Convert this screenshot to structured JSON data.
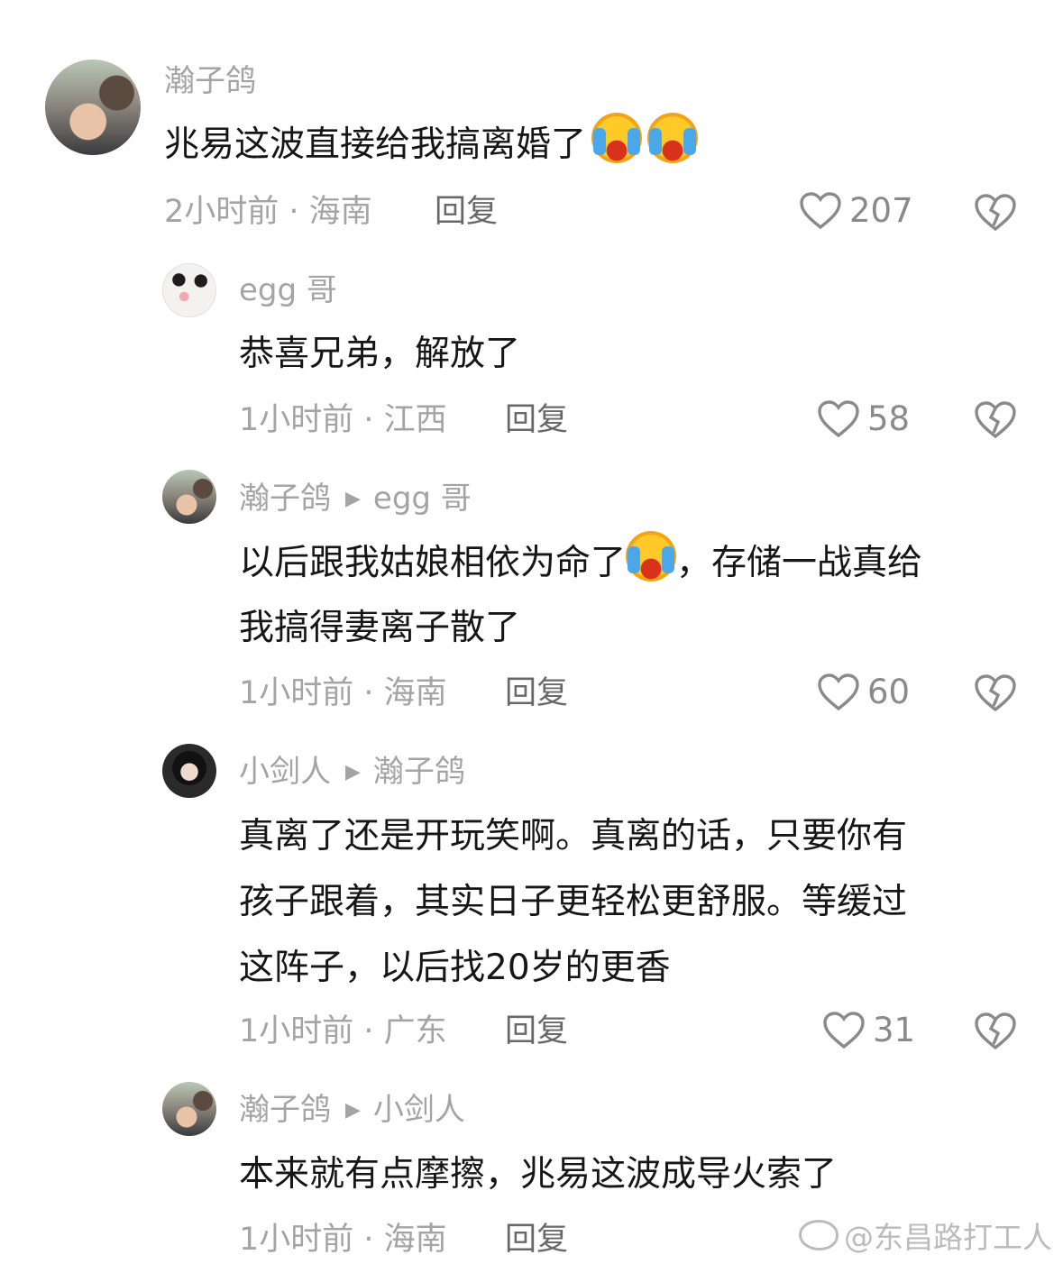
{
  "comments": [
    {
      "username": "瀚子鸽",
      "text": "兆易这波直接给我搞离婚了",
      "time_location": "2小时前 · 海南",
      "reply_label": "回复",
      "likes": "207"
    },
    {
      "username": "egg 哥",
      "text": "恭喜兄弟，解放了",
      "time_location": "1小时前 · 江西",
      "reply_label": "回复",
      "likes": "58"
    },
    {
      "username": "瀚子鸽",
      "reply_to": "egg 哥",
      "text_line1_a": "以后跟我姑娘相依为命了",
      "text_line1_b": "，存储一战真给",
      "text_line2": "我搞得妻离子散了",
      "time_location": "1小时前 · 海南",
      "reply_label": "回复",
      "likes": "60"
    },
    {
      "username": "小剑人",
      "reply_to": "瀚子鸽",
      "text_line1": "真离了还是开玩笑啊。真离的话，只要你有",
      "text_line2": "孩子跟着，其实日子更轻松更舒服。等缓过",
      "text_line3": "这阵子，以后找20岁的更香",
      "time_location": "1小时前 · 广东",
      "reply_label": "回复",
      "likes": "31"
    },
    {
      "username": "瀚子鸽",
      "reply_to": "小剑人",
      "text": "本来就有点摩擦，兆易这波成导火索了",
      "time_location": "1小时前 · 海南",
      "reply_label": "回复"
    }
  ],
  "watermark": "@东昌路打工人",
  "colors": {
    "meta": "#a4a4a4",
    "text": "#161616",
    "reply": "#686868"
  }
}
